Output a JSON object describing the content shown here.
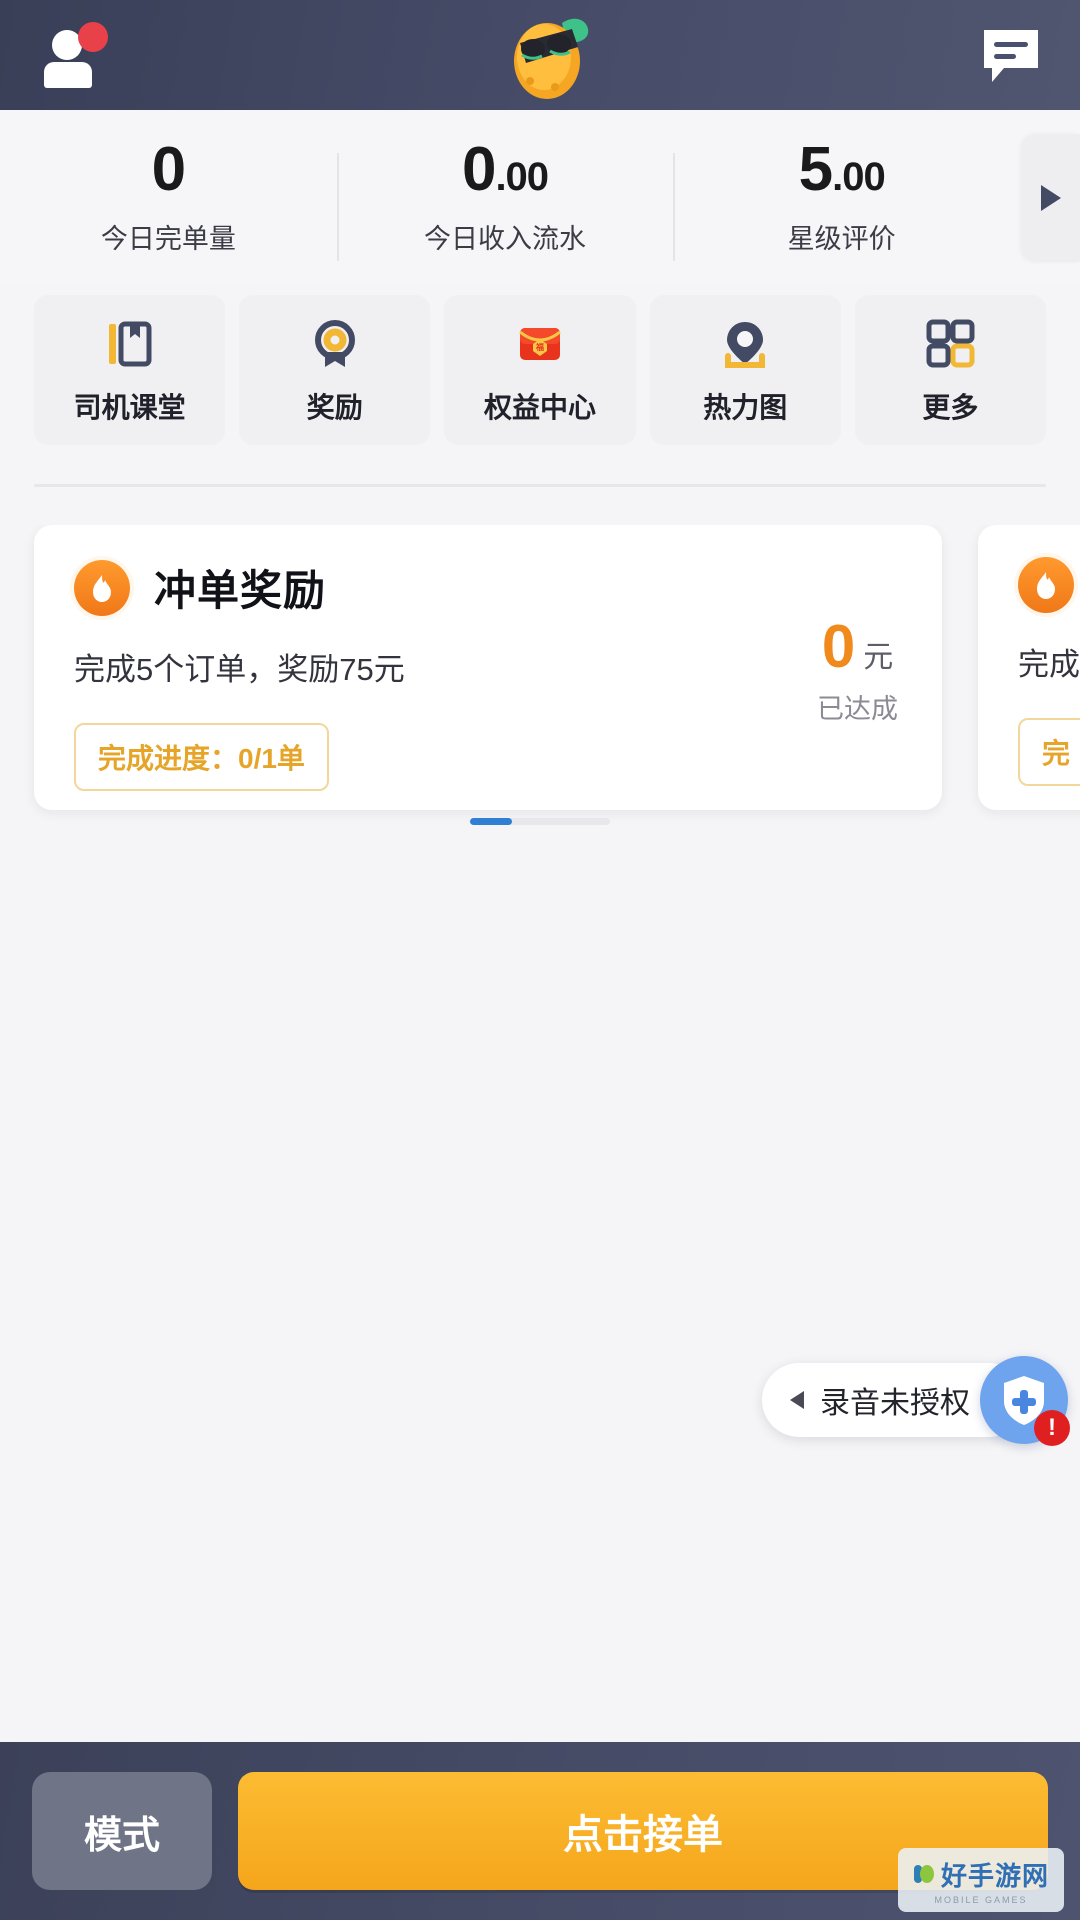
{
  "header": {
    "avatar_icon": "person-icon",
    "avatar_badge": "notification-dot",
    "logo_icon": "orange-sunglasses-logo",
    "chat_icon": "chat-bubble-icon"
  },
  "stats": {
    "more_icon": "play-arrow-icon",
    "items": [
      {
        "int": "0",
        "dec": "",
        "label": "今日完单量"
      },
      {
        "int": "0",
        "dec": ".00",
        "label": "今日收入流水"
      },
      {
        "int": "5",
        "dec": ".00",
        "label": "星级评价"
      }
    ]
  },
  "quick_actions": [
    {
      "label": "司机课堂",
      "icon": "book-icon"
    },
    {
      "label": "奖励",
      "icon": "medal-icon"
    },
    {
      "label": "权益中心",
      "icon": "red-envelope-icon"
    },
    {
      "label": "热力图",
      "icon": "map-pin-icon"
    },
    {
      "label": "更多",
      "icon": "grid-icon"
    }
  ],
  "reward_cards": [
    {
      "badge_icon": "flame-icon",
      "title": "冲单奖励",
      "subtitle": "完成5个订单，奖励75元",
      "amount": "0",
      "amount_unit": "元",
      "amount_note": "已达成",
      "progress": "完成进度：0/1单"
    },
    {
      "badge_icon": "flame-icon",
      "title": "",
      "subtitle": "完成",
      "amount": "",
      "amount_unit": "",
      "amount_note": "",
      "progress": "完"
    }
  ],
  "permission_float": {
    "back_icon": "chevron-left-icon",
    "label": "录音未授权",
    "fab_icon": "shield-plus-icon",
    "alert_badge": "!"
  },
  "bottom_bar": {
    "mode_label": "模式",
    "accept_label": "点击接单"
  },
  "watermark": {
    "text": "好手游网",
    "subtitle": "MOBILE GAMES"
  },
  "colors": {
    "header_bg": "#474d69",
    "accent_orange": "#f5a61b",
    "reward_orange": "#f08a1c",
    "progress_gold": "#e6a528",
    "navy_icon": "#434a63",
    "alert_red": "#e02020",
    "indicator_blue": "#2f7fd4"
  }
}
